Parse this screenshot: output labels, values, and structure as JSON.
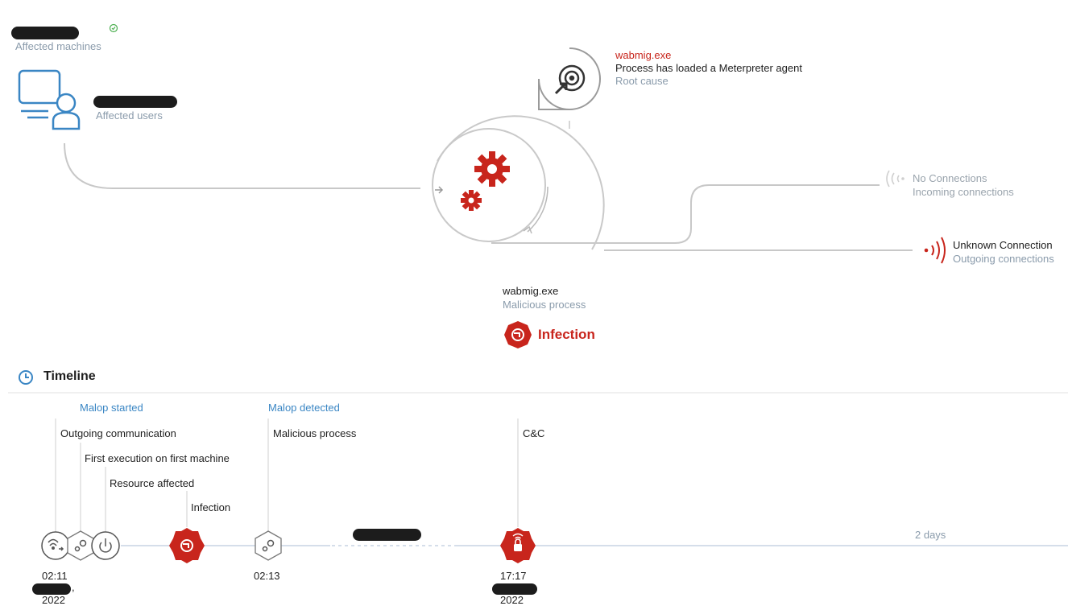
{
  "machines": {
    "label": "Affected machines"
  },
  "users": {
    "label": "Affected users"
  },
  "root_cause": {
    "process_name": "wabmig.exe",
    "description": "Process has loaded a Meterpreter agent",
    "label": "Root cause"
  },
  "incoming": {
    "title": "No Connections",
    "label": "Incoming connections"
  },
  "outgoing": {
    "title": "Unknown Connection",
    "label": "Outgoing connections"
  },
  "malicious_process": {
    "name": "wabmig.exe",
    "label": "Malicious process"
  },
  "infection_badge": {
    "label": "Infection"
  },
  "timeline": {
    "title": "Timeline",
    "malop_started": "Malop started",
    "malop_detected": "Malop detected",
    "events": [
      {
        "label": "Outgoing communication"
      },
      {
        "label": "First execution on first machine"
      },
      {
        "label": "Resource affected"
      },
      {
        "label": "Infection"
      },
      {
        "label": "Malicious process"
      },
      {
        "label": "C&C"
      }
    ],
    "times": [
      "02:11",
      "02:13",
      "17:17"
    ],
    "years": [
      "2022",
      "2022"
    ],
    "date_suffix": ",",
    "gap_label": "2 days"
  },
  "colors": {
    "accent_blue": "#3a86c4",
    "alert_red": "#c8251c",
    "muted_text": "#8a9bab",
    "line_gray": "#c8c8c8"
  }
}
